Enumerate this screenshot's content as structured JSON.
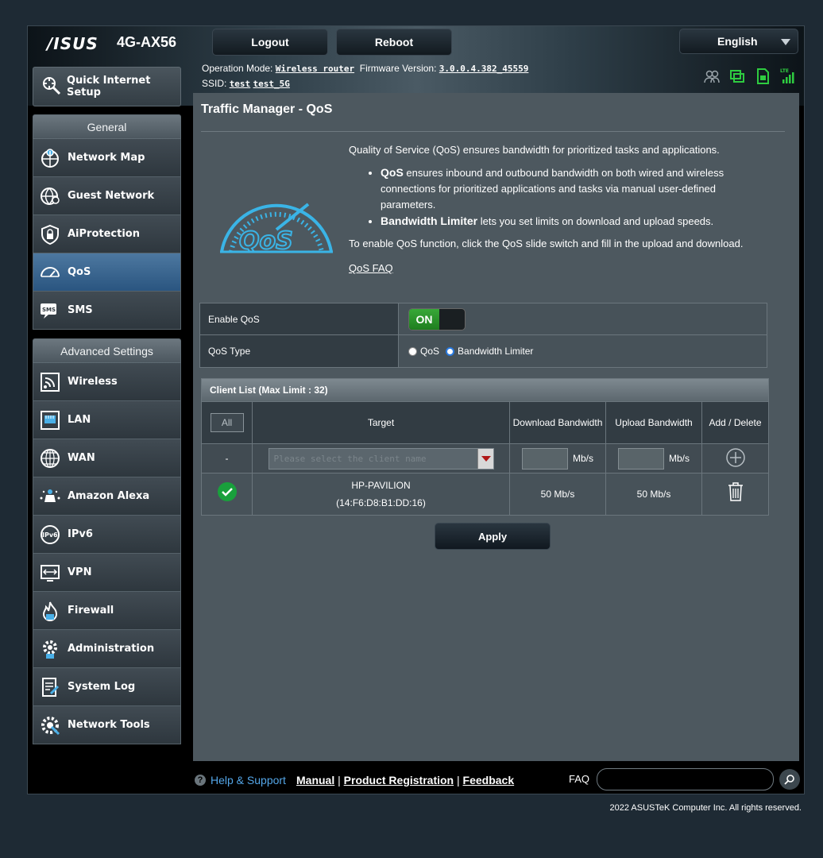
{
  "header": {
    "brand": "/ISUS",
    "model": "4G-AX56",
    "logout_label": "Logout",
    "reboot_label": "Reboot",
    "language": "English",
    "operation_mode_label": "Operation Mode:",
    "operation_mode_value": "Wireless router",
    "firmware_label": "Firmware Version:",
    "firmware_value": "3.0.0.4.382_45559",
    "ssid_label": "SSID:",
    "ssid_1": "test",
    "ssid_2": "test_5G"
  },
  "sidebar": {
    "quick_setup": "Quick Internet Setup",
    "general_heading": "General",
    "general_items": [
      {
        "label": "Network Map",
        "icon": "network-map-icon"
      },
      {
        "label": "Guest Network",
        "icon": "guest-network-icon"
      },
      {
        "label": "AiProtection",
        "icon": "shield-icon"
      },
      {
        "label": "QoS",
        "icon": "speedometer-icon"
      },
      {
        "label": "SMS",
        "icon": "sms-icon"
      }
    ],
    "advanced_heading": "Advanced Settings",
    "advanced_items": [
      {
        "label": "Wireless",
        "icon": "wireless-icon"
      },
      {
        "label": "LAN",
        "icon": "lan-icon"
      },
      {
        "label": "WAN",
        "icon": "globe-icon"
      },
      {
        "label": "Amazon Alexa",
        "icon": "alexa-icon"
      },
      {
        "label": "IPv6",
        "icon": "ipv6-icon"
      },
      {
        "label": "VPN",
        "icon": "vpn-icon"
      },
      {
        "label": "Firewall",
        "icon": "firewall-icon"
      },
      {
        "label": "Administration",
        "icon": "gear-icon"
      },
      {
        "label": "System Log",
        "icon": "log-icon"
      },
      {
        "label": "Network Tools",
        "icon": "tools-icon"
      }
    ],
    "active_item": "QoS"
  },
  "main": {
    "title": "Traffic Manager - QoS",
    "intro": "Quality of Service (QoS) ensures bandwidth for prioritized tasks and applications.",
    "bullet1_bold": "QoS",
    "bullet1_text": " ensures inbound and outbound bandwidth on both wired and wireless connections for prioritized applications and tasks via manual user-defined parameters.",
    "bullet2_bold": "Bandwidth Limiter",
    "bullet2_text": " lets you set limits on download and upload speeds.",
    "enable_text": "To enable QoS function, click the QoS slide switch and fill in the upload and download.",
    "faq_link": "QoS FAQ",
    "enable_qos_label": "Enable QoS",
    "toggle_state": "ON",
    "qos_type_label": "QoS Type",
    "qos_type_options": [
      "QoS",
      "Bandwidth Limiter"
    ],
    "qos_type_selected": "Bandwidth Limiter"
  },
  "client_list": {
    "title": "Client List (Max Limit : 32)",
    "all_label": "All",
    "columns": [
      "Target",
      "Download Bandwidth",
      "Upload Bandwidth",
      "Add / Delete"
    ],
    "new_row": {
      "index": "-",
      "placeholder": "Please select the client name",
      "download_unit": "Mb/s",
      "upload_unit": "Mb/s"
    },
    "rows": [
      {
        "name": "HP-PAVILION",
        "mac": "(14:F6:D8:B1:DD:16)",
        "download": "50 Mb/s",
        "upload": "50 Mb/s"
      }
    ]
  },
  "apply_label": "Apply",
  "footer": {
    "help_support": "Help & Support",
    "manual": "Manual",
    "product_registration": "Product Registration",
    "feedback": "Feedback",
    "faq_label": "FAQ",
    "copyright": "2022 ASUSTeK Computer Inc. All rights reserved."
  },
  "colors": {
    "accent_green": "#2ecc40",
    "qos_blue": "#3ab4e6",
    "active_menu": "#3d6a95",
    "link_blue": "#54a6e8"
  }
}
